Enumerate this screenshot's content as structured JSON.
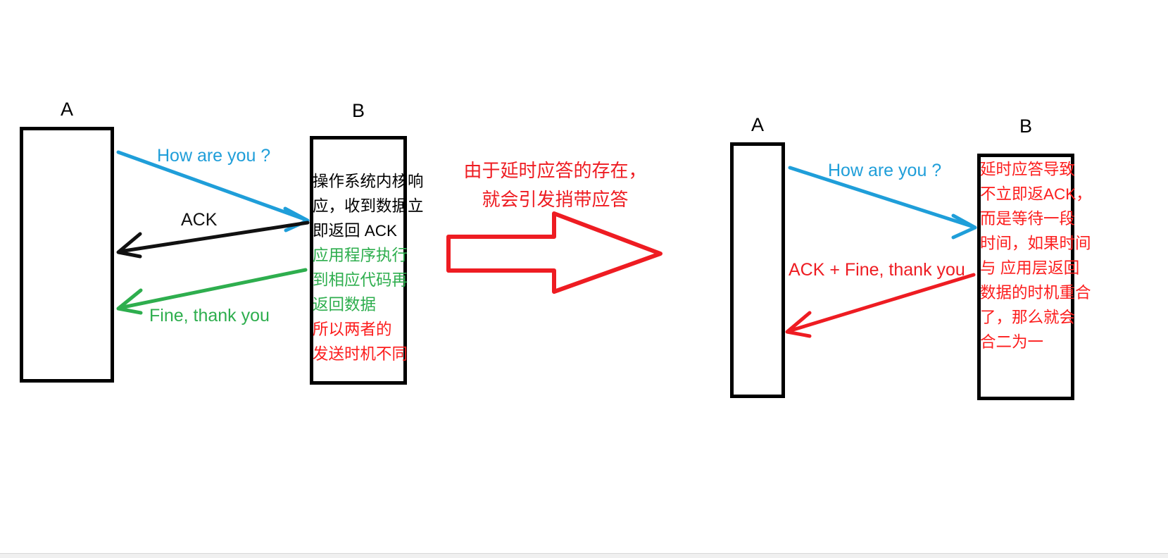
{
  "diagram": {
    "title_note": "TCP delayed ACK leading to piggyback ACK",
    "colors": {
      "blue": "#1f9ed9",
      "black": "#000000",
      "green": "#2eae4e",
      "red": "#ee1c22",
      "red_text": "#fc1d1d",
      "background": "#ffffff"
    },
    "left_panel": {
      "host_a_label": "A",
      "host_b_label": "B",
      "arrows": [
        {
          "label": "How are you ?",
          "color": "#1f9ed9",
          "direction": "a-to-b"
        },
        {
          "label": "ACK",
          "color": "#000000",
          "direction": "b-to-a"
        },
        {
          "label": "Fine, thank you",
          "color": "#2eae4e",
          "direction": "b-to-a"
        }
      ],
      "b_notes": [
        {
          "color": "black",
          "lines": [
            "操作系统内核响",
            "应，收到数据立",
            "即返回 ACK"
          ]
        },
        {
          "color": "green",
          "lines": [
            "应用程序执行",
            "到相应代码再",
            "返回数据"
          ]
        },
        {
          "color": "red",
          "lines": [
            "所以两者的",
            "发送时机不同"
          ]
        }
      ]
    },
    "center": {
      "caption_lines": [
        "由于延时应答的存在，",
        "就会引发捎带应答"
      ],
      "arrow_icon": "right-block-arrow"
    },
    "right_panel": {
      "host_a_label": "A",
      "host_b_label": "B",
      "arrows": [
        {
          "label": "How are you ?",
          "color": "#1f9ed9",
          "direction": "a-to-b"
        },
        {
          "label": "ACK + Fine, thank you",
          "color": "#ee1c22",
          "direction": "b-to-a"
        }
      ],
      "b_notes": [
        {
          "color": "red",
          "lines": [
            "延时应答导致",
            "不立即返ACK，",
            "而是等待一段",
            "时间，如果时间",
            "与 应用层返回",
            "数据的时机重合",
            "了，那么就会",
            "合二为一"
          ]
        }
      ]
    }
  }
}
